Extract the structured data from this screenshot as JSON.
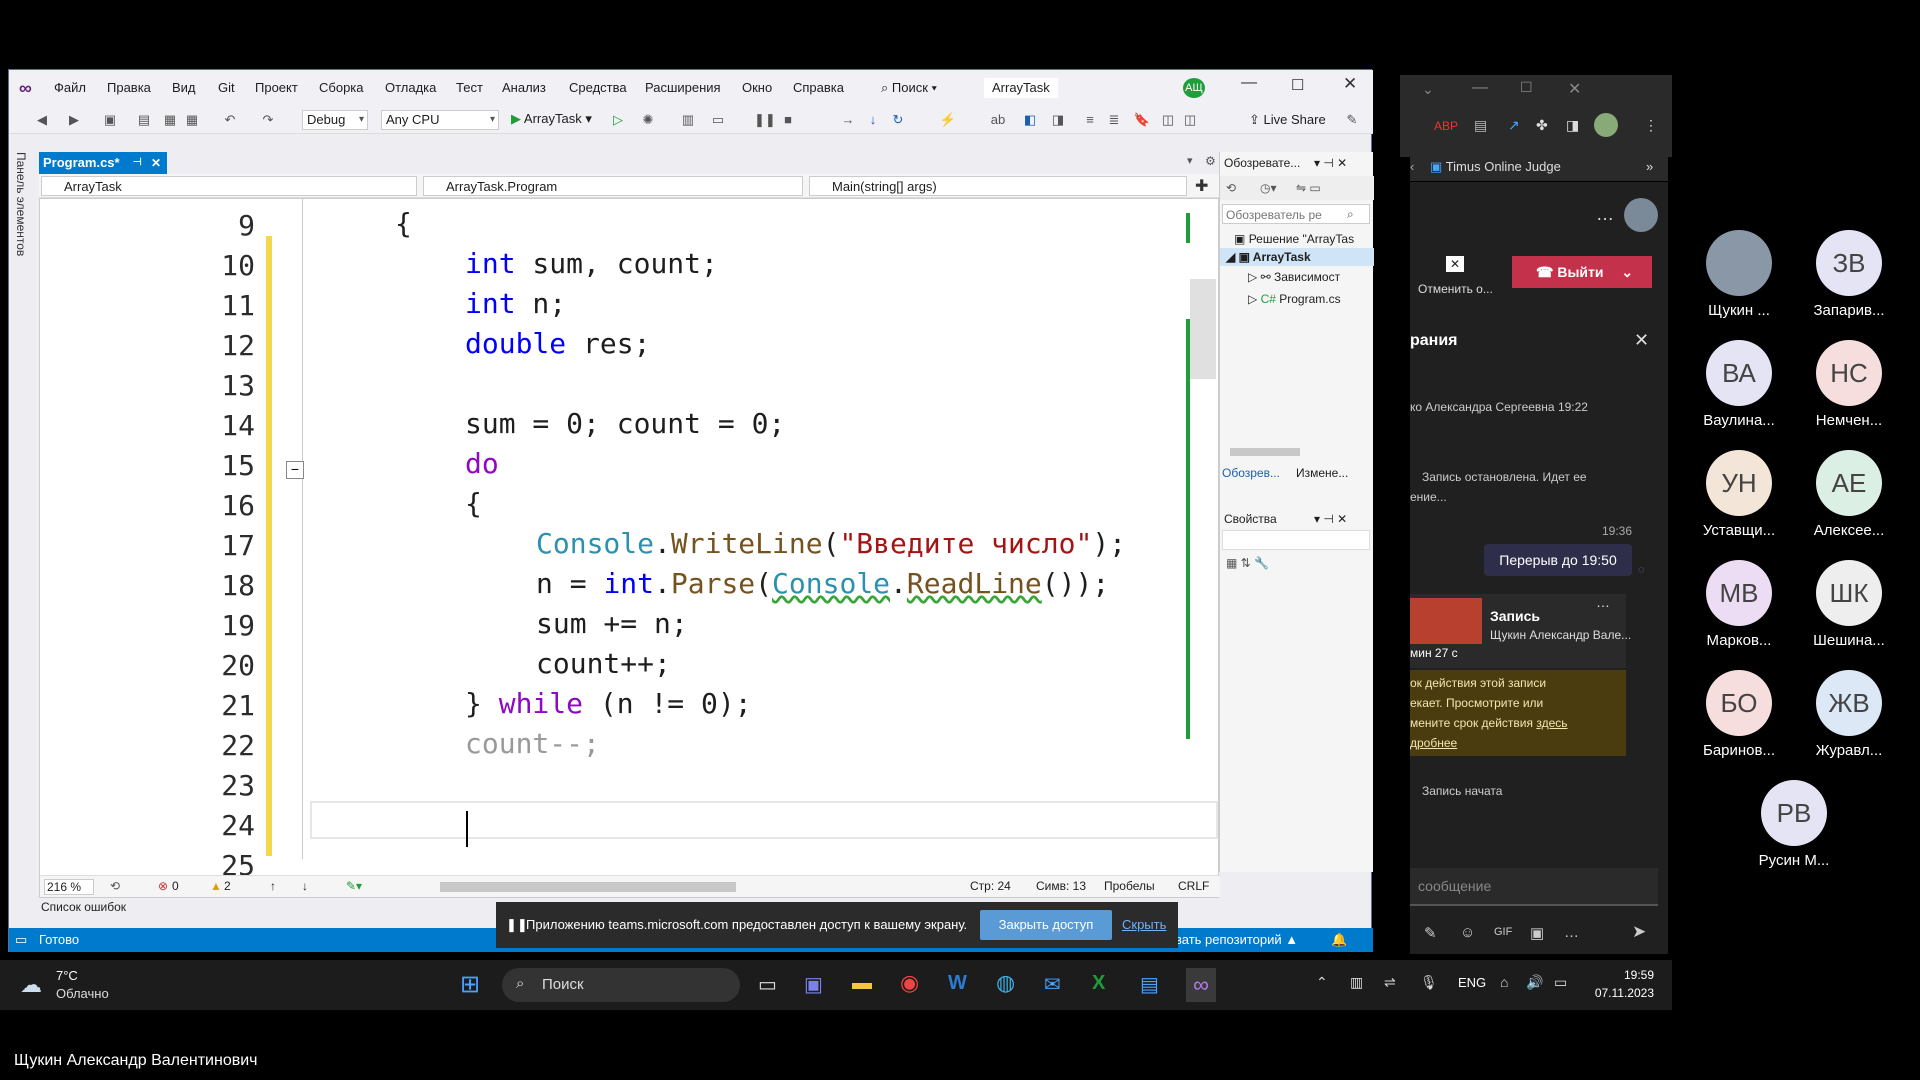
{
  "vs": {
    "menu": [
      "Файл",
      "Правка",
      "Вид",
      "Git",
      "Проект",
      "Сборка",
      "Отладка",
      "Тест",
      "Анализ",
      "Средства",
      "Расширения",
      "Окно",
      "Справка"
    ],
    "search_label": "Поиск",
    "window_title": "ArrayTask",
    "user_badge": "АЩ",
    "toolbar": {
      "config": "Debug",
      "platform": "Any CPU",
      "run_target": "ArrayTask",
      "live_share": "Live Share"
    },
    "left_strip_label": "Панель элементов",
    "tab": {
      "label": "Program.cs*"
    },
    "nav": {
      "project": "ArrayTask",
      "class": "ArrayTask.Program",
      "member": "Main(string[] args)"
    },
    "code_lines": [
      {
        "num": "9"
      },
      {
        "num": "10"
      },
      {
        "num": "11"
      },
      {
        "num": "12"
      },
      {
        "num": "13"
      },
      {
        "num": "14"
      },
      {
        "num": "15"
      },
      {
        "num": "16"
      },
      {
        "num": "17"
      },
      {
        "num": "18"
      },
      {
        "num": "19"
      },
      {
        "num": "20"
      },
      {
        "num": "21"
      },
      {
        "num": "22"
      },
      {
        "num": "23"
      },
      {
        "num": "24"
      },
      {
        "num": "25"
      }
    ],
    "code": {
      "l9": "{",
      "l10_kw": "int",
      "l10_rest": " sum, count;",
      "l11_kw": "int",
      "l11_rest": " n;",
      "l12_kw": "double",
      "l12_rest": " res;",
      "l14": "sum = 0; count = 0;",
      "l15": "do",
      "l16": "{",
      "l17_cls": "Console",
      "l17_dot": ".",
      "l17_meth": "WriteLine",
      "l17_open": "(",
      "l17_str": "\"Введите число\"",
      "l17_close": ");",
      "l18_a": "n = ",
      "l18_kw": "int",
      "l18_b": ".",
      "l18_meth": "Parse",
      "l18_c": "(",
      "l18_cls": "Console",
      "l18_d": ".",
      "l18_meth2": "ReadLine",
      "l18_e": "());",
      "l19": "sum += n;",
      "l20": "count++;",
      "l21_a": "} ",
      "l21_kw": "while",
      "l21_b": " (n != 0);",
      "l22": "count--;"
    },
    "solution": {
      "title": "Обозревате...",
      "search_placeholder": "Обозреватель ре",
      "solution_item": "Решение \"ArrayTas",
      "project_item": "ArrayTask",
      "deps_item": "Зависимост",
      "file_item": "Program.cs",
      "tab1": "Обозрев...",
      "tab2": "Измене..."
    },
    "properties": {
      "title": "Свойства"
    },
    "editor_status": {
      "zoom": "216 %",
      "errors": "0",
      "warnings": "2",
      "line": "Стр: 24",
      "col": "Симв: 13",
      "spaces": "Пробелы",
      "eol": "CRLF"
    },
    "error_list": "Список ошибок",
    "status": {
      "ready": "Готово",
      "repo": "вать репозиторий"
    }
  },
  "share_bar": {
    "message": "Приложению teams.microsoft.com предоставлен доступ к вашему экрану.",
    "close_access": "Закрыть доступ",
    "hide": "Скрыть"
  },
  "browser": {
    "tab_title": "Timus Online Judge"
  },
  "teams": {
    "cancel_label": "Отменить о...",
    "leave_label": "Выйти",
    "panel_title": "рания",
    "msg1_author": "ко Александра Сергеевна",
    "msg1_time": "19:22",
    "msg2": "Запись остановлена. Идет ее",
    "msg2b": "ение...",
    "time3": "19:36",
    "bubble": "Перерыв до 19:50",
    "rec_title": "Запись",
    "rec_author": "Щукин Александр Вале...",
    "rec_dur": "мин 27 с",
    "warn1": "ок действия этой записи",
    "warn2": "екает. Просмотрите или",
    "warn3": "мените срок действия",
    "warn_link": "здесь",
    "warn4": "дробнее",
    "rec_started": "Запись начата",
    "compose": "сообщение"
  },
  "participants": [
    {
      "initials": "",
      "name": "Щукин ..."
    },
    {
      "initials": "ЗВ",
      "name": "Запарив..."
    },
    {
      "initials": "ВА",
      "name": "Ваулина..."
    },
    {
      "initials": "НС",
      "name": "Немчен..."
    },
    {
      "initials": "УН",
      "name": "Уставщи..."
    },
    {
      "initials": "АЕ",
      "name": "Алексее..."
    },
    {
      "initials": "МВ",
      "name": "Марков..."
    },
    {
      "initials": "ШК",
      "name": "Шешина..."
    },
    {
      "initials": "БО",
      "name": "Баринов..."
    },
    {
      "initials": "ЖВ",
      "name": "Журавл..."
    },
    {
      "initials": "РВ",
      "name": "Русин М..."
    }
  ],
  "taskbar": {
    "weather_temp": "7°C",
    "weather_desc": "Облачно",
    "search": "Поиск",
    "lang": "ENG",
    "time": "19:59",
    "date": "07.11.2023"
  },
  "caption": "Щукин Александр Валентинович",
  "colors": {
    "accent": "#007acc",
    "leave": "#c4314b",
    "bubble": "#2e2e4a"
  }
}
